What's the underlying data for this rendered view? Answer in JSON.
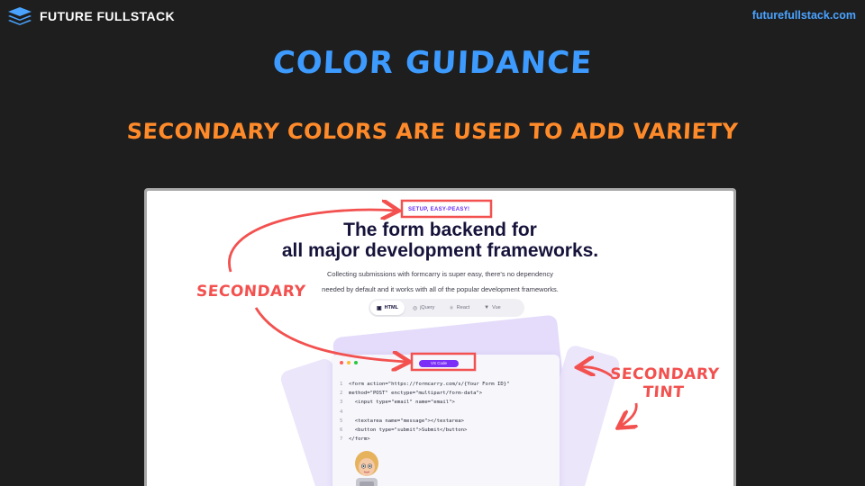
{
  "header": {
    "brand_name": "FUTURE FULLSTACK",
    "site_url": "futurefullstack.com"
  },
  "slide": {
    "title": "COLOR GUIDANCE",
    "subtitle": "SECONDARY COLORS ARE USED TO ADD VARIETY"
  },
  "screenshot": {
    "tagline": "SETUP, EASY-PEASY!",
    "hero_line_1": "The form backend for",
    "hero_line_2": "all major development frameworks.",
    "desc_line_1": "Collecting submissions with formcarry is super easy, there's no dependency",
    "desc_line_2": "needed by default and it works with all of the popular development frameworks.",
    "tabs": [
      {
        "label": "HTML",
        "icon": "html5-icon",
        "active": true
      },
      {
        "label": "jQuery",
        "icon": "jquery-icon",
        "active": false
      },
      {
        "label": "React",
        "icon": "react-icon",
        "active": false
      },
      {
        "label": "Vue",
        "icon": "vue-icon",
        "active": false
      }
    ],
    "code_button": "VS Code",
    "code_lines": [
      {
        "n": "1",
        "text": "<form action=\"https://formcarry.com/s/{Your Form ID}\""
      },
      {
        "n": "2",
        "text": "method=\"POST\" enctype=\"multipart/form-data\">"
      },
      {
        "n": "3",
        "text": "  <input type=\"email\" name=\"email\">"
      },
      {
        "n": "4",
        "text": ""
      },
      {
        "n": "5",
        "text": "  <textarea name=\"message\"></textarea>"
      },
      {
        "n": "6",
        "text": "  <button type=\"submit\">Submit</button>"
      },
      {
        "n": "7",
        "text": "</form>"
      }
    ]
  },
  "annotations": {
    "secondary_label": "SECONDARY",
    "tint_label_1": "SECONDARY",
    "tint_label_2": "TINT"
  },
  "colors": {
    "background": "#1e1e1e",
    "title": "#3d9bff",
    "subtitle": "#ff8a2a",
    "annotation": "#f2514f",
    "secondary": "#7b2ff7",
    "secondary_tint": "#ece6fb"
  }
}
